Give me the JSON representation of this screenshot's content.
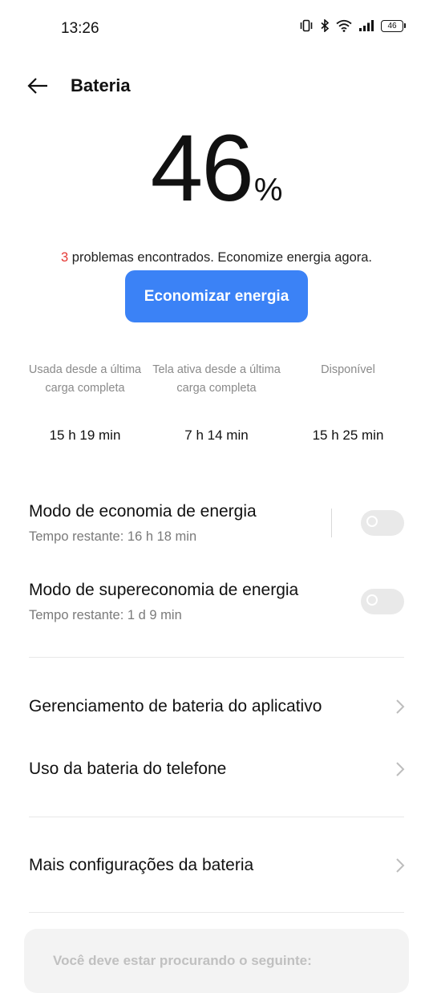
{
  "status_bar": {
    "time": "13:26",
    "battery_level": "46",
    "icons": [
      "vibrate-icon",
      "bluetooth-icon",
      "wifi-icon",
      "signal-icon",
      "battery-icon"
    ]
  },
  "header": {
    "title": "Bateria",
    "back_icon": "arrow-left-icon"
  },
  "battery": {
    "percent_value": "46",
    "percent_sign": "%"
  },
  "problems": {
    "count": "3",
    "text": " problemas encontrados. Economize energia agora."
  },
  "save_button": {
    "label": "Economizar energia",
    "color": "#3b82f6"
  },
  "stats": [
    {
      "label": "Usada desde a última carga completa",
      "value": "15 h 19 min"
    },
    {
      "label": "Tela ativa desde a última carga completa",
      "value": "7 h 14 min"
    },
    {
      "label": "Disponível",
      "value": "15 h 25 min"
    }
  ],
  "power_saving": {
    "title": "Modo de economia de energia",
    "subtitle": "Tempo restante:  16 h 18 min",
    "enabled": false
  },
  "super_power_saving": {
    "title": "Modo de supereconomia de energia",
    "subtitle": "Tempo restante:  1 d 9 min",
    "enabled": false
  },
  "nav": {
    "app_battery": "Gerenciamento de bateria do aplicativo",
    "phone_usage": "Uso da bateria do telefone",
    "more_settings": "Mais configurações da bateria"
  },
  "suggestion": {
    "text": "Você deve estar procurando o seguinte:"
  }
}
